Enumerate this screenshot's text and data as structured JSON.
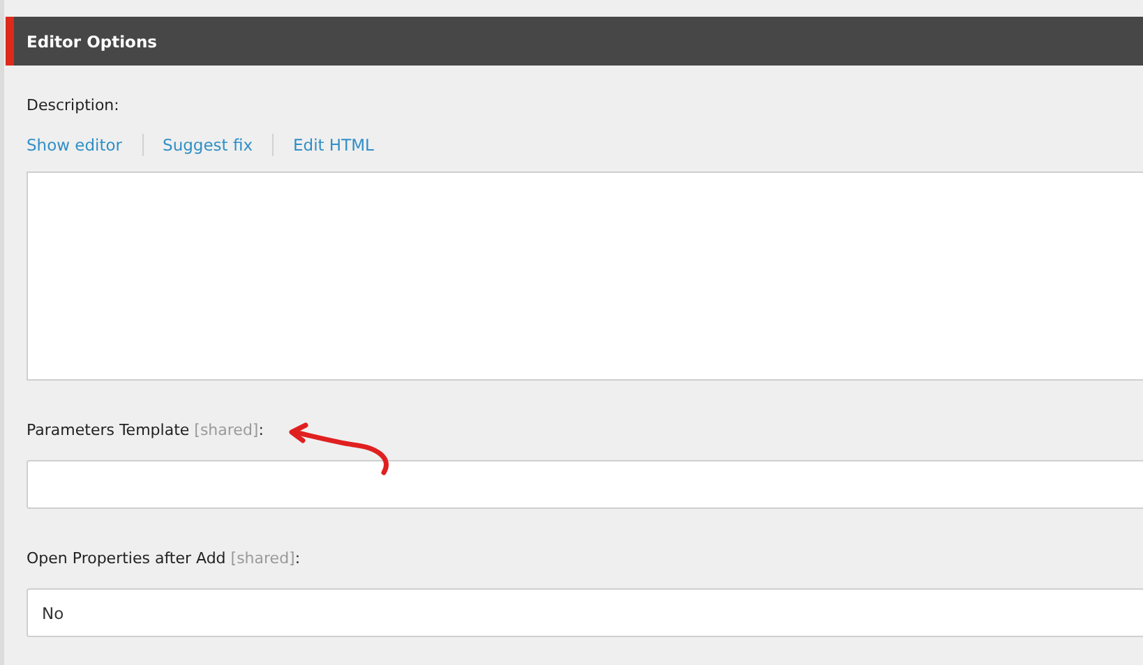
{
  "section": {
    "title": "Editor Options"
  },
  "description": {
    "label": "Description:",
    "links": [
      "Show editor",
      "Suggest fix",
      "Edit HTML"
    ]
  },
  "fields": [
    {
      "label": "Parameters Template",
      "tag": "[shared]",
      "suffix": ":"
    },
    {
      "label": "Open Properties after Add",
      "tag": "[shared]",
      "suffix": ":",
      "value": "No"
    }
  ]
}
